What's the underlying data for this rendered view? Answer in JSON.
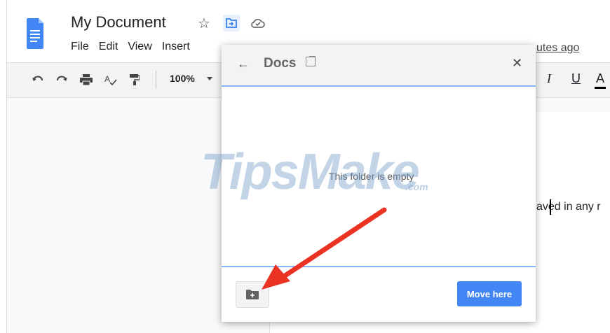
{
  "header": {
    "doc_title": "My Document",
    "menu": [
      "File",
      "Edit",
      "View",
      "Insert"
    ],
    "last_edit": "utes ago",
    "icons": {
      "doc": "google-docs-icon",
      "star": "star-icon",
      "move": "move-to-folder-icon",
      "status": "cloud-saved-icon"
    }
  },
  "toolbar": {
    "zoom": "100%",
    "icons": [
      "undo-icon",
      "redo-icon",
      "print-icon",
      "spellcheck-icon",
      "paint-format-icon"
    ],
    "format": {
      "italic": "I",
      "underline": "U",
      "text_color": "A"
    }
  },
  "document": {
    "body_text": "aved in any r"
  },
  "watermark": {
    "text": "TipsMake",
    "suffix": ".com"
  },
  "move_dialog": {
    "title": "Docs",
    "empty_message": "This folder is empty",
    "move_button": "Move here",
    "icons": {
      "back": "arrow-back-icon",
      "open": "open-in-new-icon",
      "close": "close-icon",
      "new_folder": "new-folder-icon"
    }
  },
  "colors": {
    "accent": "#4285f4",
    "divider": "#8ab4f8",
    "annotation_arrow": "#ea3323"
  }
}
